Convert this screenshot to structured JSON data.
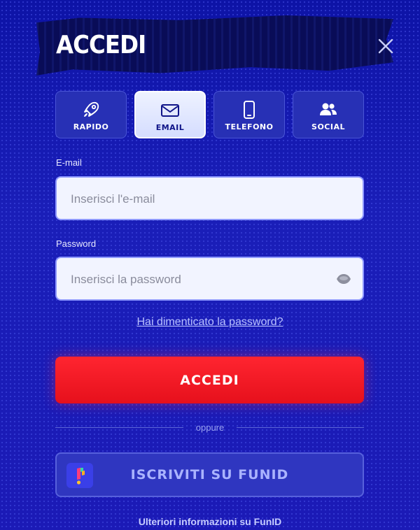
{
  "header": {
    "title": "ACCEDI"
  },
  "tabs": [
    {
      "label": "RAPIDO",
      "icon": "rocket-icon",
      "active": false
    },
    {
      "label": "EMAIL",
      "icon": "envelope-icon",
      "active": true
    },
    {
      "label": "TELEFONO",
      "icon": "phone-icon",
      "active": false
    },
    {
      "label": "SOCIAL",
      "icon": "users-icon",
      "active": false
    }
  ],
  "form": {
    "email_label": "E-mail",
    "email_placeholder": "Inserisci l'e-mail",
    "password_label": "Password",
    "password_placeholder": "Inserisci la password",
    "forgot_password": "Hai dimenticato la password?",
    "submit_label": "ACCEDI"
  },
  "divider": {
    "text": "oppure"
  },
  "funid": {
    "button_label": "ISCRIVITI SU FUNID",
    "more_info": "Ulteriori informazioni su FunID"
  },
  "colors": {
    "background": "#1b1fb4",
    "accent_red": "#ff2530",
    "active_tab": "#eef2ff"
  }
}
